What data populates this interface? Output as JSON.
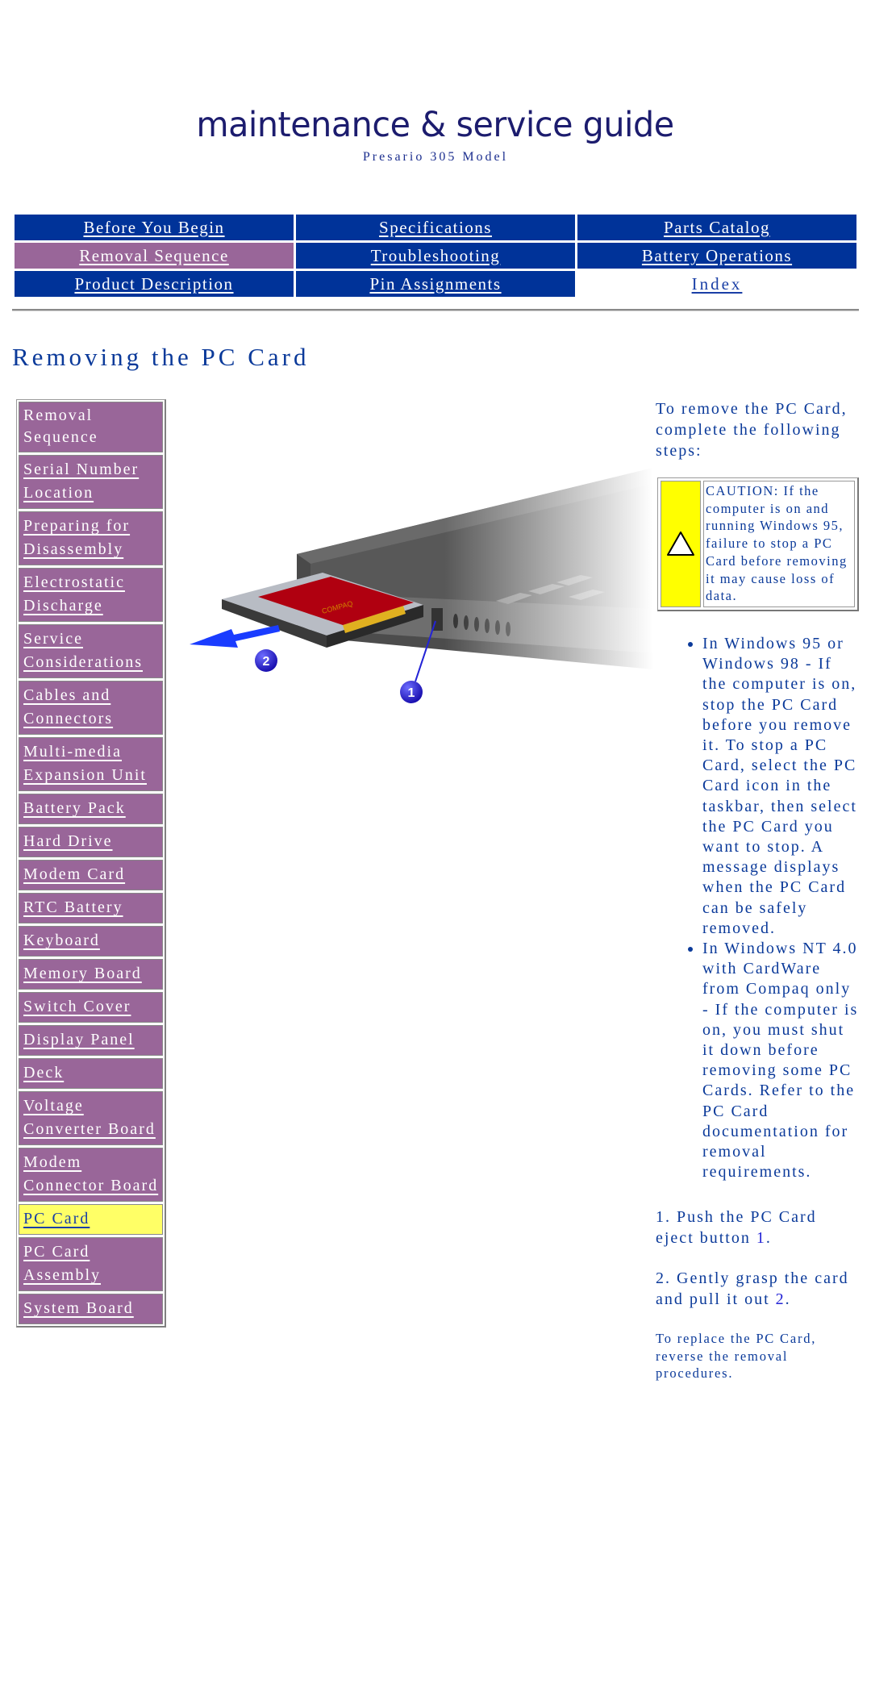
{
  "header": {
    "title": "maintenance & service guide",
    "subtitle": "Presario 305 Model"
  },
  "topnav": {
    "rows": [
      [
        {
          "label": "Before You Begin",
          "state": "normal"
        },
        {
          "label": "Specifications",
          "state": "normal"
        },
        {
          "label": "Parts Catalog",
          "state": "normal"
        }
      ],
      [
        {
          "label": "Removal Sequence",
          "state": "active"
        },
        {
          "label": "Troubleshooting",
          "state": "normal"
        },
        {
          "label": "Battery Operations",
          "state": "normal"
        }
      ],
      [
        {
          "label": "Product Description",
          "state": "normal"
        },
        {
          "label": "Pin Assignments",
          "state": "normal"
        },
        {
          "label": "Index",
          "state": "plain"
        }
      ]
    ]
  },
  "page_title": "Removing the PC Card",
  "sidenav": {
    "heading": "Removal Sequence",
    "items": [
      {
        "label": "Serial Number Location"
      },
      {
        "label": "Preparing for Disassembly"
      },
      {
        "label": "Electrostatic Discharge"
      },
      {
        "label": "Service Considerations"
      },
      {
        "label": "Cables and Connectors"
      },
      {
        "label": "Multi-media Expansion Unit"
      },
      {
        "label": "Battery Pack"
      },
      {
        "label": "Hard Drive"
      },
      {
        "label": "Modem Card"
      },
      {
        "label": "RTC Battery"
      },
      {
        "label": "Keyboard"
      },
      {
        "label": "Memory Board"
      },
      {
        "label": "Switch Cover"
      },
      {
        "label": "Display Panel"
      },
      {
        "label": "Deck"
      },
      {
        "label": "Voltage Converter Board"
      },
      {
        "label": "Modem Connector Board"
      },
      {
        "label": "PC Card",
        "current": true
      },
      {
        "label": "PC Card Assembly"
      },
      {
        "label": "System Board"
      }
    ]
  },
  "illustration": {
    "description": "PC Card being pulled out of the notebook PC Card slot",
    "callouts": [
      "1",
      "2"
    ],
    "colors": {
      "card_label": "#b00010",
      "arrow": "#1a3cff",
      "callout": "#2a1fd0",
      "chassis": "#555555"
    }
  },
  "content": {
    "intro": "To remove the PC Card, complete the following steps:",
    "caution": {
      "icon": "warning-triangle-icon",
      "text": "CAUTION: If the computer is on and running Windows 95, failure to stop a PC Card before removing it may cause loss of data."
    },
    "bullets": [
      "In Windows 95 or Windows 98 - If the computer is on, stop the PC Card before you remove it. To stop a PC Card, select the PC Card icon in the taskbar, then select the PC Card you want to stop. A message displays when the PC Card can be safely removed.",
      "In Windows NT 4.0 with CardWare from Compaq only - If the computer is on, you must shut it down before removing some PC Cards. Refer to the PC Card documentation for removal requirements."
    ],
    "steps": [
      {
        "prefix": "1. Push the PC Card eject button ",
        "ref": "1",
        "suffix": "."
      },
      {
        "prefix": "2. Gently grasp the card and pull it out ",
        "ref": "2",
        "suffix": "."
      }
    ],
    "replace_note": "To replace the PC Card, reverse the removal procedures."
  },
  "colors": {
    "nav_blue": "#003399",
    "nav_active": "#996699",
    "sidenav_bg": "#996699",
    "sidenav_current": "#ffff66",
    "text_blue": "#0b3a9a",
    "caution_yellow": "#ffff00"
  }
}
